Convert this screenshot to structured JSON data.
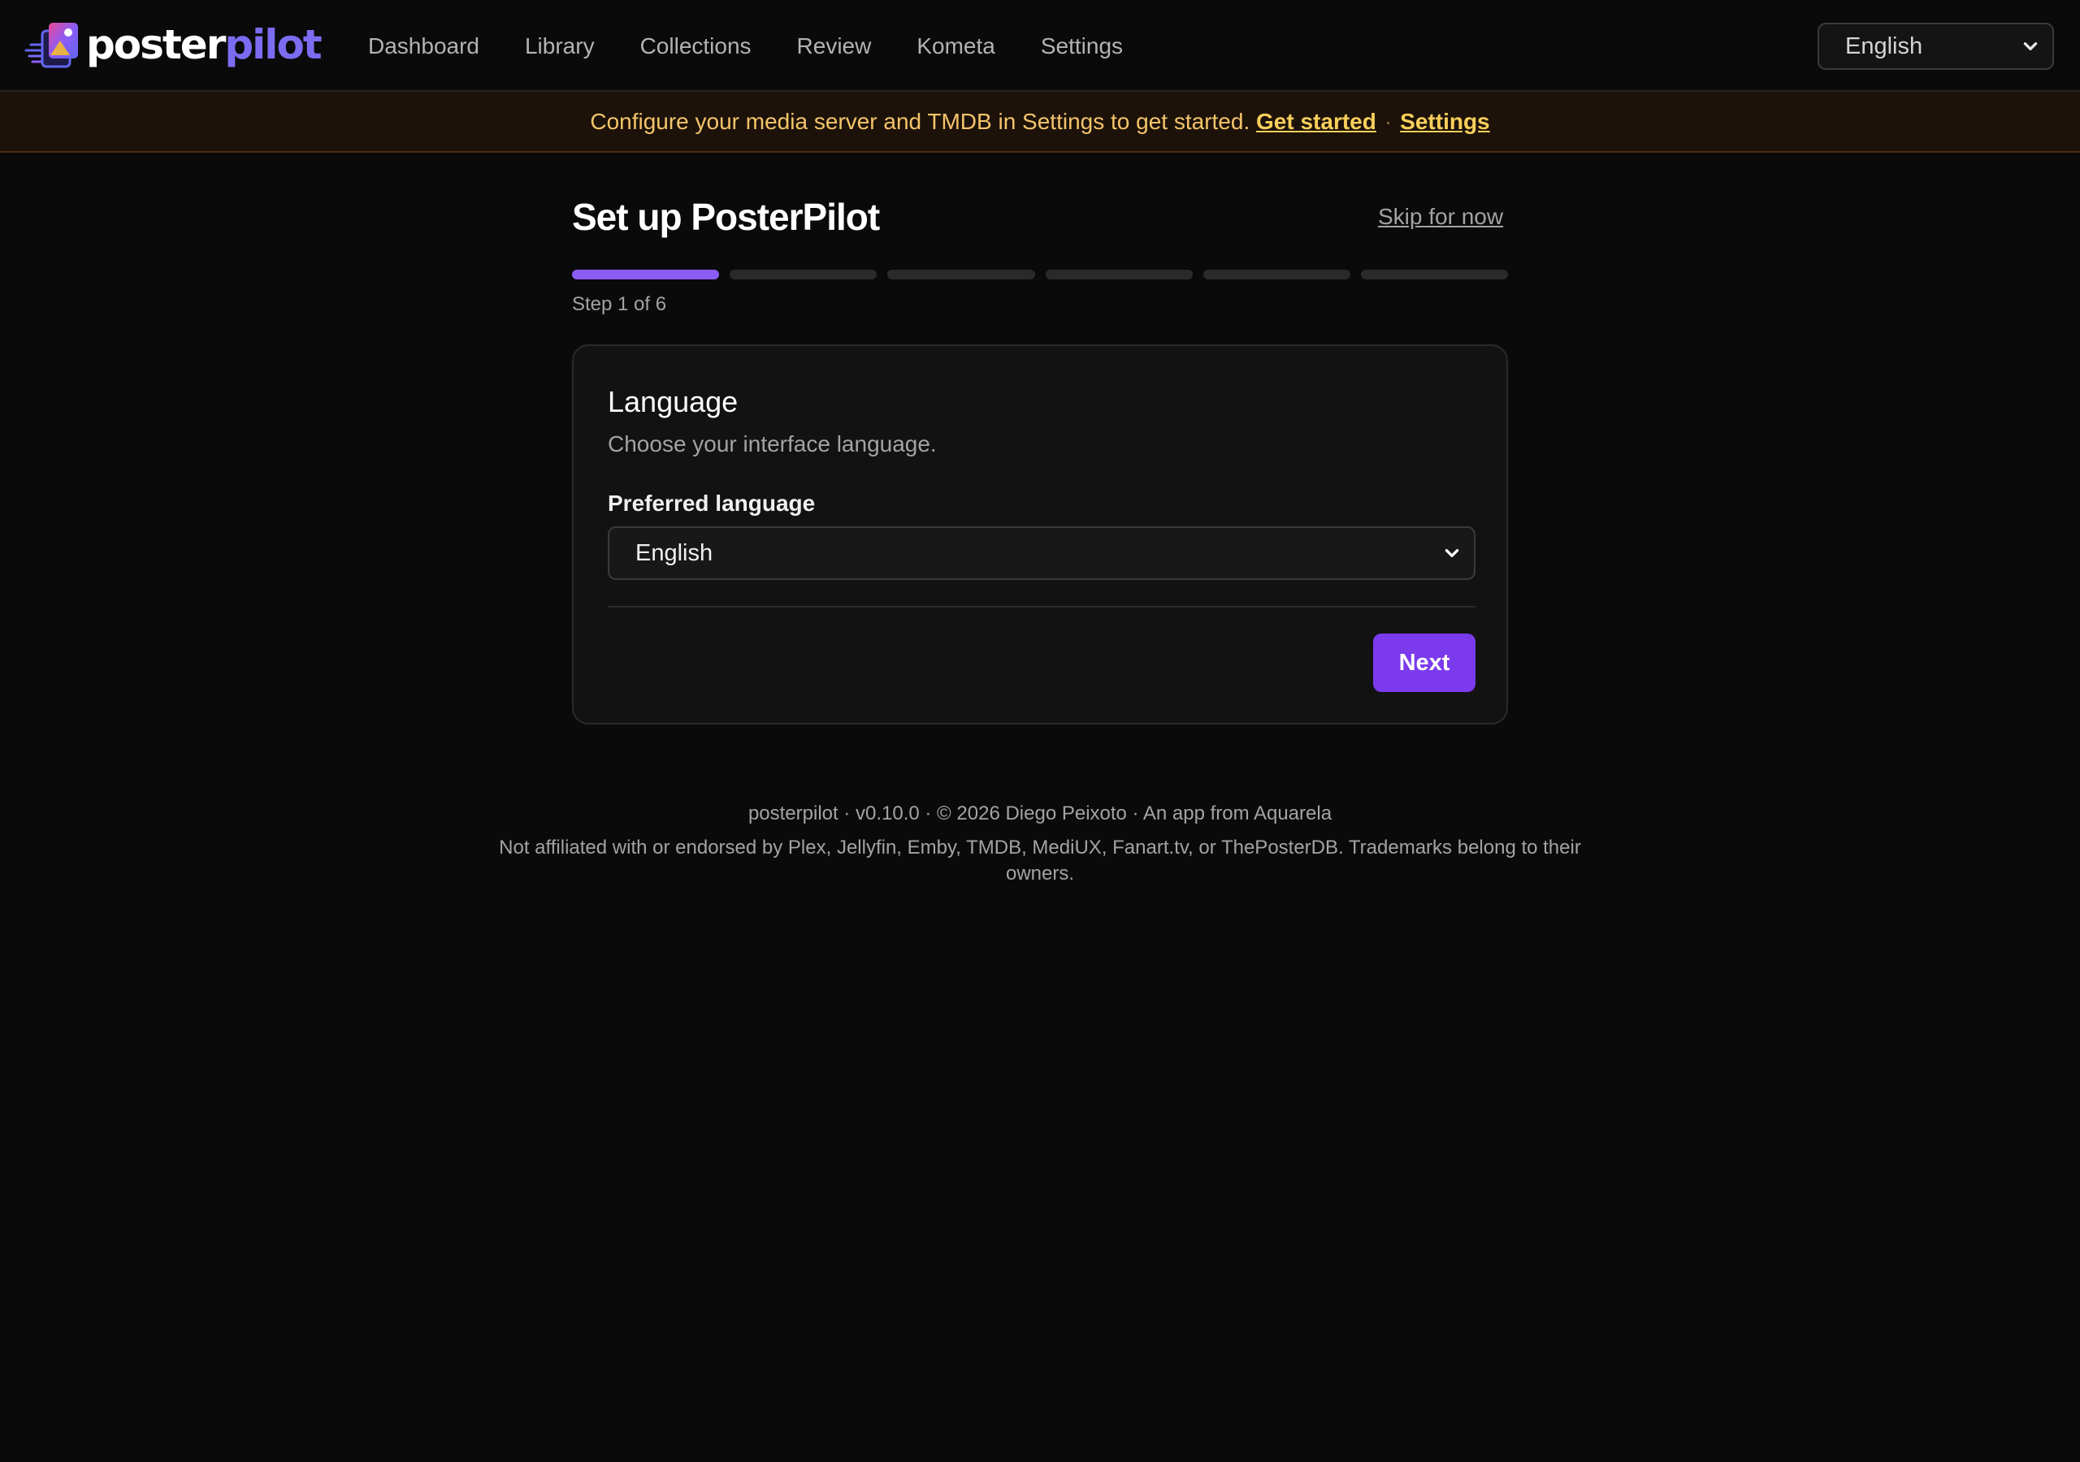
{
  "brand": {
    "name_part1": "poster",
    "name_part2": "pilot"
  },
  "nav": {
    "items": [
      {
        "label": "Dashboard"
      },
      {
        "label": "Library"
      },
      {
        "label": "Collections"
      },
      {
        "label": "Review"
      },
      {
        "label": "Kometa"
      },
      {
        "label": "Settings"
      }
    ],
    "language_select": {
      "value": "English",
      "icon": "chevron-down-icon"
    }
  },
  "banner": {
    "message": "Configure your media server and TMDB in Settings to get started.",
    "get_started_link": "Get started",
    "separator": "·",
    "settings_link": "Settings"
  },
  "wizard": {
    "title": "Set up PosterPilot",
    "skip_label": "Skip for now",
    "progress": {
      "current_step": 1,
      "total_steps": 6
    },
    "step_text": "Step 1 of 6",
    "card": {
      "title": "Language",
      "subtitle": "Choose your interface language.",
      "field_label": "Preferred language",
      "selected_value": "English",
      "next_label": "Next"
    }
  },
  "footer": {
    "line1": "posterpilot · v0.10.0 · © 2026 Diego Peixoto · An app from Aquarela",
    "line2": "Not affiliated with or endorsed by Plex, Jellyfin, Emby, TMDB, MediUX, Fanart.tv, or ThePosterDB. Trademarks belong to their owners."
  },
  "colors": {
    "accent": "#8b5cf6",
    "button": "#7c3aed",
    "banner_text": "#f5c46a",
    "background": "#0a0a0a"
  }
}
